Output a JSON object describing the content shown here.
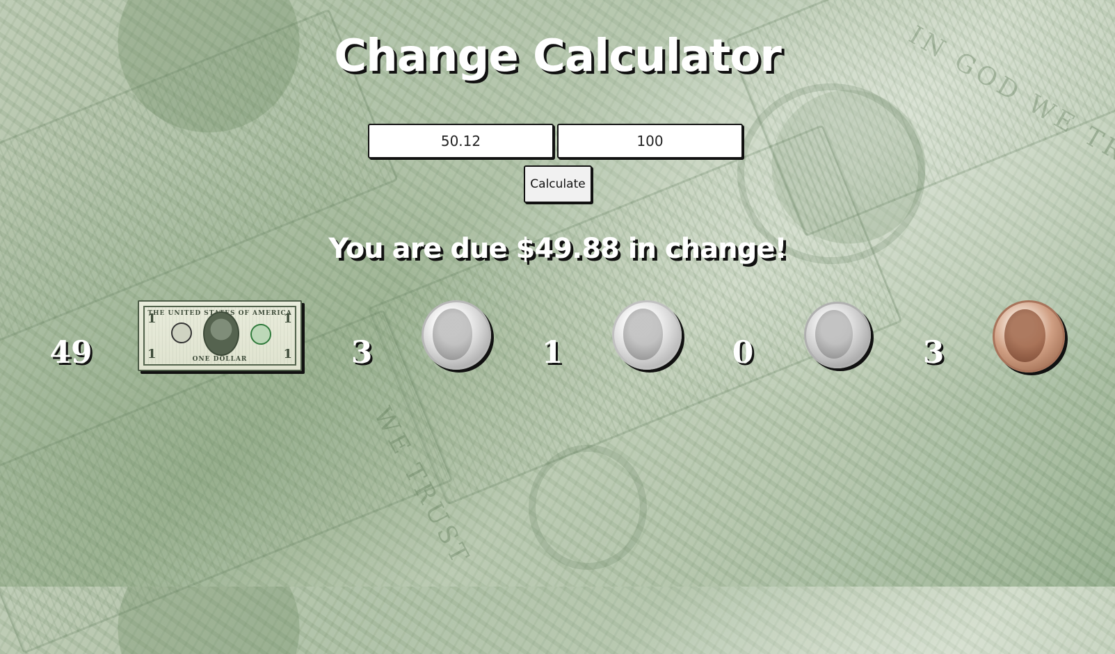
{
  "page": {
    "title": "Change Calculator"
  },
  "form": {
    "price_value": "50.12",
    "paid_value": "100",
    "calculate_label": "Calculate"
  },
  "result": {
    "message": "You are due $49.88 in change!"
  },
  "denominations": [
    {
      "name": "dollar bill",
      "count": "49",
      "icon": "dollar-bill-icon"
    },
    {
      "name": "quarter",
      "count": "3",
      "icon": "quarter-coin-icon"
    },
    {
      "name": "dime",
      "count": "1",
      "icon": "dime-coin-icon"
    },
    {
      "name": "nickel",
      "count": "0",
      "icon": "nickel-coin-icon"
    },
    {
      "name": "penny",
      "count": "3",
      "icon": "penny-coin-icon"
    }
  ],
  "bill": {
    "top_caption": "THE UNITED STATES OF AMERICA",
    "bottom_caption": "ONE DOLLAR",
    "numeral": "1"
  },
  "colors": {
    "heading_text": "#ffffff",
    "text_shadow": "#111111",
    "background_tint": "#a9bca0"
  }
}
